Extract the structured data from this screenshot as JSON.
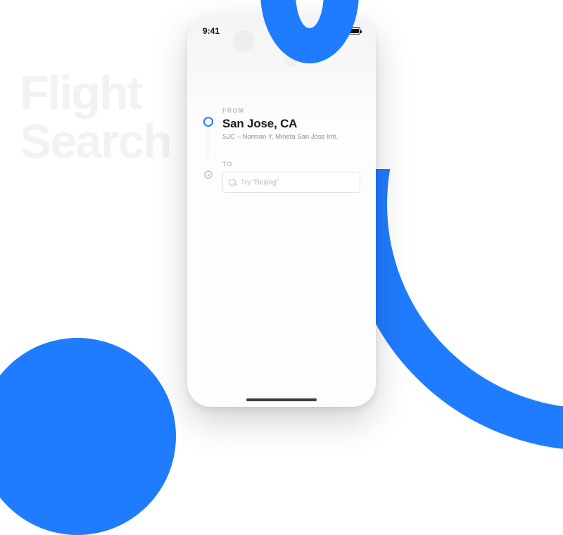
{
  "background": {
    "title_line1": "Flight",
    "title_line2": "Search",
    "accent_color": "#1f7cff"
  },
  "status": {
    "time": "9:41"
  },
  "from": {
    "label": "FROM",
    "city": "San Jose, CA",
    "detail": "SJC – Norman Y. Mineta San Jose Intl."
  },
  "to": {
    "label": "TO",
    "placeholder": "Try \"Beijing\""
  }
}
